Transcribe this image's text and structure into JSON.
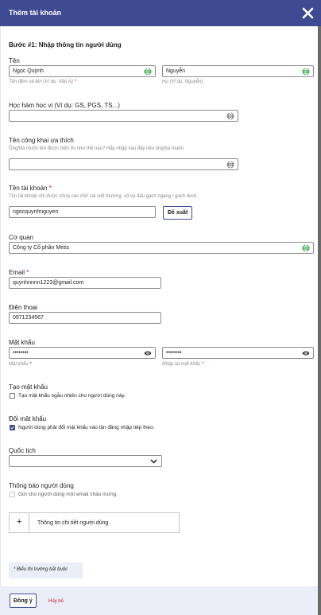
{
  "header": {
    "title": "Thêm tài khoản",
    "close_icon": "close-icon"
  },
  "step": {
    "title": "Bước #1: Nhập thông tin người dùng"
  },
  "name": {
    "label": "Tên",
    "given_value": "Ngọc Quỳnh",
    "given_hint": "Tên đệm và tên (Ví dụ: Văn A)",
    "given_req": "*",
    "family_value": "Nguyễn",
    "family_hint": "Họ (Ví dụ: Nguyễn)"
  },
  "academic": {
    "label": "Học hàm học vị (Ví dụ: GS, PGS, TS...)",
    "value": ""
  },
  "public_name": {
    "label": "Tên công khai ưa thích",
    "desc": "Ông/Bà muốn tên được hiển thị như thế nào? Hãy nhập vào đây nếu ông/bà muốn.",
    "value": ""
  },
  "username": {
    "label": "Tên tài khoản",
    "req": "*",
    "desc": "Tên tài khoản chỉ được chứa các chữ cái viết thường, số và dấu gạch ngang / gạch dưới.",
    "value": "ngocquynhnguyen",
    "suggest_label": "Đề xuất"
  },
  "organization": {
    "label": "Cơ quan",
    "value": "Công ty Cổ phần Metis"
  },
  "email": {
    "label": "Email",
    "req": "*",
    "value": "quynhnnnn1223@gmail.com"
  },
  "phone": {
    "label": "Điện thoại",
    "value": "0971234567"
  },
  "password": {
    "label": "Mật khẩu",
    "value": "••••••••",
    "hint": "Mật khẩu",
    "req": "*",
    "repeat_value": "••••••••",
    "repeat_hint": "Nhập lại mật khẩu"
  },
  "create_password": {
    "label": "Tạo mật khẩu",
    "checkbox_text": "Tạo mật khẩu ngẫu nhiên cho người dùng này.",
    "checked": false
  },
  "change_password": {
    "label": "Đổi mật khẩu",
    "checkbox_text": "Người dùng phải đổi mật khẩu vào lần đăng nhập tiếp theo.",
    "checked": true
  },
  "nationality": {
    "label": "Quốc tịch",
    "value": ""
  },
  "notify": {
    "label": "Thông báo người dùng",
    "checkbox_text": "Gửi cho người dùng một email chào mừng.",
    "checked": false
  },
  "details": {
    "plus": "+",
    "label": "Thông tin chi tiết người dùng"
  },
  "required_note": "* Biểu thị trường bắt buộc",
  "footer": {
    "ok_label": "Đồng ý",
    "cancel_label": "Hủy bỏ"
  },
  "colors": {
    "header": "#3e4b93",
    "required": "#c8102e",
    "globe": "#2a9d3e",
    "footer": "#eceef7"
  }
}
